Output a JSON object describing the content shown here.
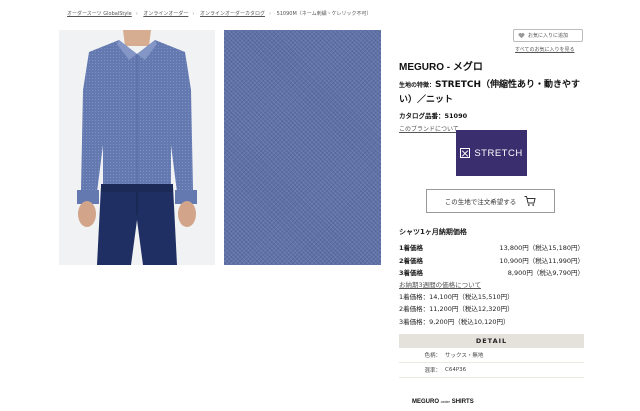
{
  "breadcrumb": [
    {
      "label": "オーダースーツ GlobalStyle",
      "link": true
    },
    {
      "label": "オンラインオーダー",
      "link": true
    },
    {
      "label": "オンラインオーダーカタログ",
      "link": true
    },
    {
      "label": "51090M（ネーム刺繍・ケレリック不可）",
      "link": false
    }
  ],
  "favorite": {
    "add_label": "お気に入りに追加",
    "list_label": "すべてのお気に入りを見る"
  },
  "product": {
    "brand_title": "MEGURO - メグロ",
    "feature_label": "生地の特徴：",
    "feature_value": "STRETCH（伸縮性あり・動きやすい）／ニット",
    "catalog_label": "カタログ品番：",
    "catalog_no": "51090",
    "brand_link": "このブランドについて"
  },
  "badge": {
    "text": "STRETCH",
    "color": "#3b2e6e"
  },
  "order_button": {
    "label": "この生地で注文希望する",
    "icon": "cart-icon"
  },
  "prices": {
    "heading": "シャツ1ヶ月納期価格",
    "rows": [
      {
        "name": "1着価格",
        "price": "13,800円（税込15,180円）"
      },
      {
        "name": "2着価格",
        "price": "10,900円（税込11,990円）"
      },
      {
        "name": "3着価格",
        "price": "8,900円（税込9,790円）"
      }
    ],
    "express_link": "お納期3週間の価格について",
    "express_rows": [
      "1着価格：14,100円（税込15,510円）",
      "2着価格：11,200円（税込12,320円）",
      "3着価格：9,200円（税込10,120円）"
    ]
  },
  "detail": {
    "heading": "DETAIL",
    "rows": [
      {
        "key": "色柄：",
        "value": "サックス・無地"
      },
      {
        "key": "混率：",
        "value": "C64P36"
      }
    ]
  },
  "footer": {
    "logo_main": "MEGURO",
    "logo_small": "order",
    "logo_tail": "SHIRTS"
  },
  "colors": {
    "badge": "#3b2e6e",
    "detail_header": "#e5e2dc",
    "fabric": "#5f72a8"
  }
}
